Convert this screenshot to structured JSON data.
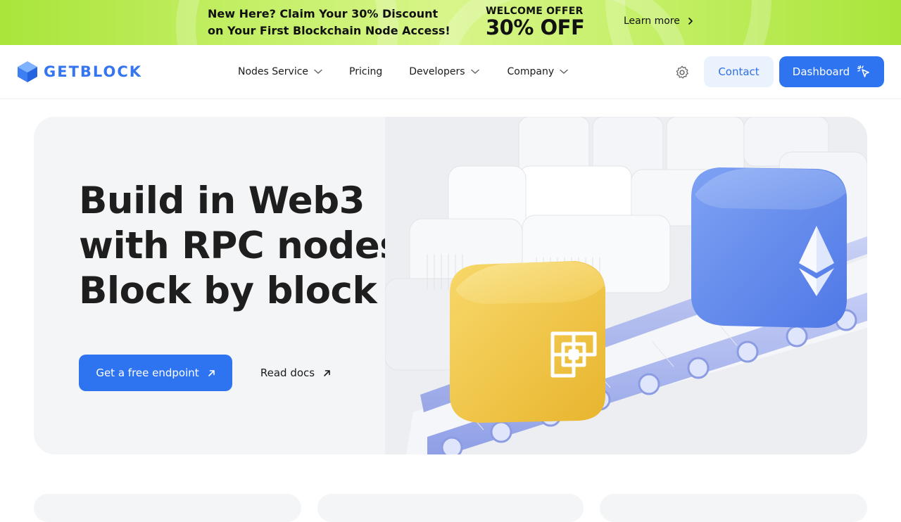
{
  "promo": {
    "line1": "New Here? Claim Your 30% Discount",
    "line2": "on Your First Blockchain Node Access!",
    "offer_small": "WELCOME OFFER",
    "offer_big": "30% OFF",
    "link_label": "Learn more"
  },
  "header": {
    "logo_text": "GETBLOCK",
    "nav": [
      {
        "label": "Nodes Service",
        "has_dropdown": true
      },
      {
        "label": "Pricing",
        "has_dropdown": false
      },
      {
        "label": "Developers",
        "has_dropdown": true
      },
      {
        "label": "Company",
        "has_dropdown": true
      }
    ],
    "contact_label": "Contact",
    "dashboard_label": "Dashboard"
  },
  "hero": {
    "title_lines": [
      "Build in Web3",
      "with RPC nodes.",
      "Block by block"
    ],
    "primary_cta": "Get a free endpoint",
    "secondary_cta": "Read docs",
    "illustration": [
      "bnb-cube-icon",
      "ethereum-cube-icon",
      "conveyor-belt"
    ]
  },
  "colors": {
    "brand_blue": "#2e74f0",
    "promo_green": "#a9e53a",
    "hero_bg": "#f4f5f7",
    "bnb_yellow": "#f3c94a",
    "eth_blue": "#6f95ee"
  }
}
